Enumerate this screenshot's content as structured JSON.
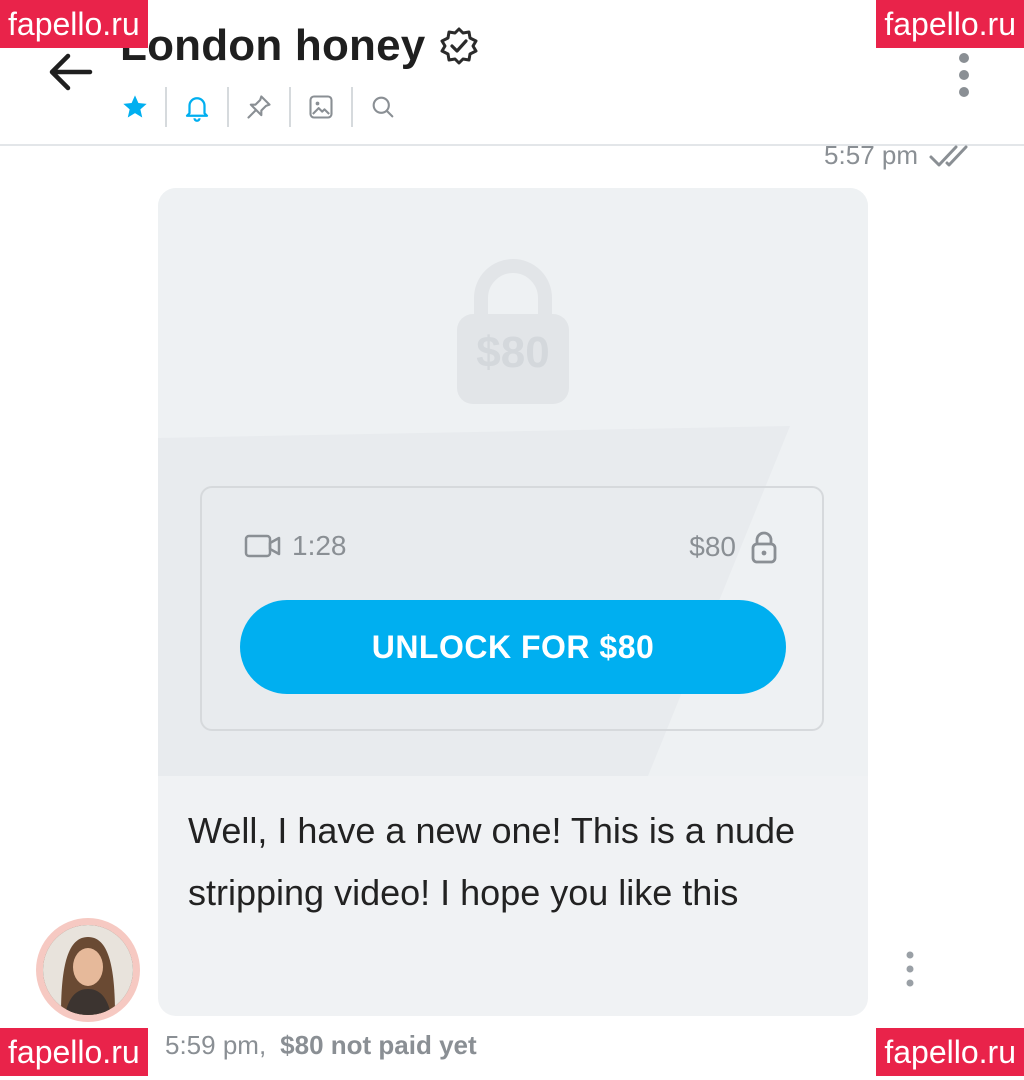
{
  "header": {
    "title": "London honey",
    "toolbar": [
      "star-icon",
      "bell-icon",
      "pin-icon",
      "image-icon",
      "search-icon"
    ],
    "accent": "#00aff0"
  },
  "message": {
    "sent_time": "5:57 pm",
    "locked_price": "$80",
    "media": {
      "duration": "1:28",
      "price": "$80"
    },
    "unlock_button": "UNLOCK FOR $80",
    "text": "Well, I have a new one! This is a nude stripping video! I hope you like this",
    "footer_time": "5:59 pm,",
    "payment_status": "$80 not paid yet"
  },
  "watermark": "fapello.ru"
}
